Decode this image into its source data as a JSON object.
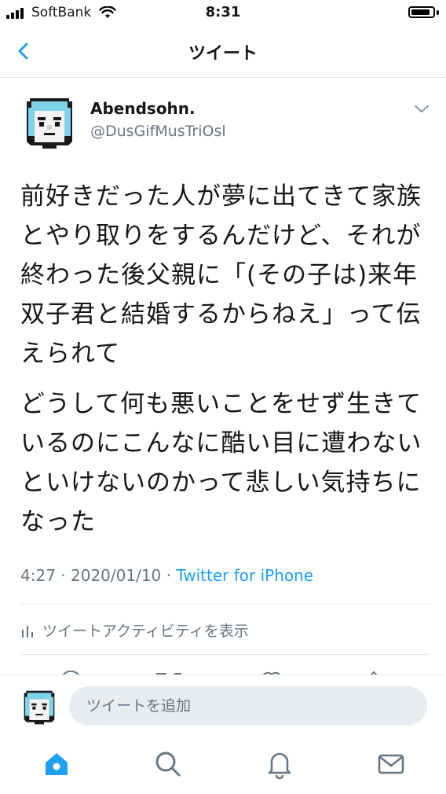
{
  "status_bar": {
    "carrier": "SoftBank",
    "time": "8:31",
    "battery_level": 0.9
  },
  "nav": {
    "title": "ツイート",
    "back_icon": "chevron-left-icon"
  },
  "tweet": {
    "display_name": "Abendsohn.",
    "handle": "@DusGifMusTriOsl",
    "paragraphs": [
      "前好きだった人が夢に出てきて家族とやり取りをするんだけど、それが終わった後父親に「(その子は)来年双子君と結婚するからねえ」って伝えられて",
      "どうして何も悪いことをせず生きているのにこんなに酷い目に遭わないといけないのかって悲しい気持ちになった"
    ],
    "time": "4:27",
    "date": "2020/01/10",
    "source": "Twitter for iPhone",
    "activity_label": "ツイートアクティビティを表示"
  },
  "reply": {
    "placeholder": "ツイートを追加"
  },
  "tabs": [
    "home-icon",
    "search-icon",
    "notifications-icon",
    "messages-icon"
  ],
  "colors": {
    "accent": "#1da1f2",
    "secondary_text": "#657786",
    "divider": "#e1e8ed",
    "input_bg": "#e6ecf0"
  }
}
